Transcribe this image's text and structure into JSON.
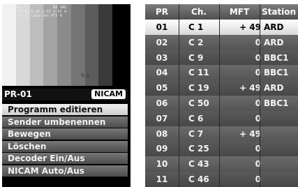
{
  "preview": {
    "osd_lines": [
      "VPS Code 1:",
      "16.12 Uhr21 0:45 1:55 2:55 d",
      "Datum Uhrz. Land Sen PTY R"
    ],
    "osd_status": "NO SND",
    "level_marker": "E-2",
    "bar_colors": [
      "#f2f2f2",
      "#d8d8d8",
      "#bdbdbd",
      "#a4a4a4",
      "#8b8b8b",
      "#747474",
      "#5c5c5c",
      "#3a3a3a"
    ]
  },
  "status": {
    "program": "PR-01",
    "audio_badge": "NICAM"
  },
  "menu": {
    "items": [
      {
        "label": "Programm editieren",
        "active": true
      },
      {
        "label": "Sender umbenennen",
        "active": false
      },
      {
        "label": "Bewegen",
        "active": false
      },
      {
        "label": "Löschen",
        "active": false
      },
      {
        "label": "Decoder Ein/Aus",
        "active": false
      },
      {
        "label": "NICAM Auto/Aus",
        "active": false
      }
    ]
  },
  "table": {
    "headers": {
      "pr": "PR",
      "ch": "Ch.",
      "mft": "MFT",
      "station": "Station"
    },
    "selected_row": 0,
    "rows": [
      {
        "pr": "01",
        "ch": "C 1",
        "mft": "+ 49",
        "station": "ARD"
      },
      {
        "pr": "02",
        "ch": "C 2",
        "mft": "0",
        "station": "ARD"
      },
      {
        "pr": "03",
        "ch": "C 9",
        "mft": "0",
        "station": "BBC1"
      },
      {
        "pr": "04",
        "ch": "C 11",
        "mft": "0",
        "station": "BBC1"
      },
      {
        "pr": "05",
        "ch": "C 19",
        "mft": "+ 49",
        "station": "ARD"
      },
      {
        "pr": "06",
        "ch": "C 50",
        "mft": "0",
        "station": "BBC1"
      },
      {
        "pr": "07",
        "ch": "C 6",
        "mft": "0",
        "station": ""
      },
      {
        "pr": "08",
        "ch": "C 7",
        "mft": "+ 49",
        "station": ""
      },
      {
        "pr": "09",
        "ch": "C 25",
        "mft": "0",
        "station": ""
      },
      {
        "pr": "10",
        "ch": "C 43",
        "mft": "0",
        "station": ""
      },
      {
        "pr": "11",
        "ch": "C 46",
        "mft": "0",
        "station": ""
      }
    ]
  }
}
